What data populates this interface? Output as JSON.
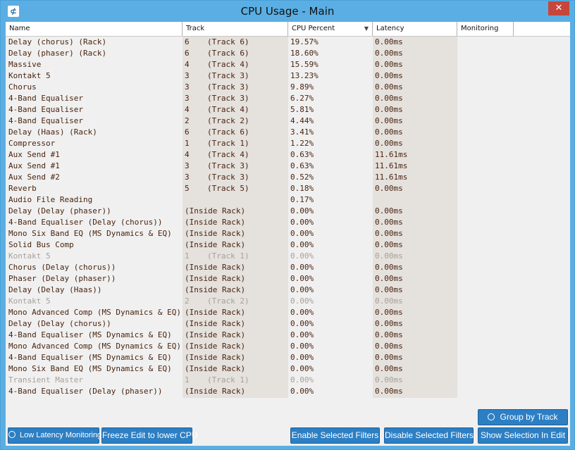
{
  "window": {
    "title": "CPU Usage - Main",
    "close_glyph": "✕",
    "app_icon_glyph": "⊄"
  },
  "table": {
    "columns": [
      "Name",
      "Track",
      "CPU Percent",
      "Latency",
      "Monitoring"
    ],
    "sorted_column": "CPU Percent",
    "sort_icon": "▼",
    "rows": [
      {
        "name": "Delay (chorus) (Rack)",
        "track_num": "6",
        "track_label": "(Track 6)",
        "cpu": "19.57%",
        "latency": "0.00ms",
        "dim": false
      },
      {
        "name": "Delay (phaser) (Rack)",
        "track_num": "6",
        "track_label": "(Track 6)",
        "cpu": "18.60%",
        "latency": "0.00ms",
        "dim": false
      },
      {
        "name": "Massive",
        "track_num": "4",
        "track_label": "(Track 4)",
        "cpu": "15.59%",
        "latency": "0.00ms",
        "dim": false
      },
      {
        "name": "Kontakt 5",
        "track_num": "3",
        "track_label": "(Track 3)",
        "cpu": "13.23%",
        "latency": "0.00ms",
        "dim": false
      },
      {
        "name": "Chorus",
        "track_num": "3",
        "track_label": "(Track 3)",
        "cpu": "9.89%",
        "latency": "0.00ms",
        "dim": false
      },
      {
        "name": "4-Band Equaliser",
        "track_num": "3",
        "track_label": "(Track 3)",
        "cpu": "6.27%",
        "latency": "0.00ms",
        "dim": false
      },
      {
        "name": "4-Band Equaliser",
        "track_num": "4",
        "track_label": "(Track 4)",
        "cpu": "5.81%",
        "latency": "0.00ms",
        "dim": false
      },
      {
        "name": "4-Band Equaliser",
        "track_num": "2",
        "track_label": "(Track 2)",
        "cpu": "4.44%",
        "latency": "0.00ms",
        "dim": false
      },
      {
        "name": "Delay (Haas) (Rack)",
        "track_num": "6",
        "track_label": "(Track 6)",
        "cpu": "3.41%",
        "latency": "0.00ms",
        "dim": false
      },
      {
        "name": "Compressor",
        "track_num": "1",
        "track_label": "(Track 1)",
        "cpu": "1.22%",
        "latency": "0.00ms",
        "dim": false
      },
      {
        "name": "Aux Send #1",
        "track_num": "4",
        "track_label": "(Track 4)",
        "cpu": "0.63%",
        "latency": "11.61ms",
        "dim": false
      },
      {
        "name": "Aux Send #1",
        "track_num": "3",
        "track_label": "(Track 3)",
        "cpu": "0.63%",
        "latency": "11.61ms",
        "dim": false
      },
      {
        "name": "Aux Send #2",
        "track_num": "3",
        "track_label": "(Track 3)",
        "cpu": "0.52%",
        "latency": "11.61ms",
        "dim": false
      },
      {
        "name": "Reverb",
        "track_num": "5",
        "track_label": "(Track 5)",
        "cpu": "0.18%",
        "latency": "0.00ms",
        "dim": false
      },
      {
        "name": "Audio File Reading",
        "track_num": "",
        "track_label": "",
        "cpu": "0.17%",
        "latency": "",
        "dim": false
      },
      {
        "name": "Delay (Delay (phaser))",
        "track_num": "(Inside Rack)",
        "track_label": "",
        "cpu": "0.00%",
        "latency": "0.00ms",
        "dim": false
      },
      {
        "name": "4-Band Equaliser (Delay (chorus))",
        "track_num": "(Inside Rack)",
        "track_label": "",
        "cpu": "0.00%",
        "latency": "0.00ms",
        "dim": false
      },
      {
        "name": "Mono Six Band EQ (MS Dynamics & EQ)",
        "track_num": "(Inside Rack)",
        "track_label": "",
        "cpu": "0.00%",
        "latency": "0.00ms",
        "dim": false
      },
      {
        "name": "Solid Bus Comp",
        "track_num": "(Inside Rack)",
        "track_label": "",
        "cpu": "0.00%",
        "latency": "0.00ms",
        "dim": false
      },
      {
        "name": "Kontakt 5",
        "track_num": "1",
        "track_label": "(Track 1)",
        "cpu": "0.00%",
        "latency": "0.00ms",
        "dim": true
      },
      {
        "name": "Chorus (Delay (chorus))",
        "track_num": "(Inside Rack)",
        "track_label": "",
        "cpu": "0.00%",
        "latency": "0.00ms",
        "dim": false
      },
      {
        "name": "Phaser (Delay (phaser))",
        "track_num": "(Inside Rack)",
        "track_label": "",
        "cpu": "0.00%",
        "latency": "0.00ms",
        "dim": false
      },
      {
        "name": "Delay (Delay (Haas))",
        "track_num": "(Inside Rack)",
        "track_label": "",
        "cpu": "0.00%",
        "latency": "0.00ms",
        "dim": false
      },
      {
        "name": "Kontakt 5",
        "track_num": "2",
        "track_label": "(Track 2)",
        "cpu": "0.00%",
        "latency": "0.00ms",
        "dim": true
      },
      {
        "name": "Mono Advanced Comp (MS Dynamics & EQ)",
        "track_num": "(Inside Rack)",
        "track_label": "",
        "cpu": "0.00%",
        "latency": "0.00ms",
        "dim": false
      },
      {
        "name": "Delay (Delay (chorus))",
        "track_num": "(Inside Rack)",
        "track_label": "",
        "cpu": "0.00%",
        "latency": "0.00ms",
        "dim": false
      },
      {
        "name": "4-Band Equaliser (MS Dynamics & EQ)",
        "track_num": "(Inside Rack)",
        "track_label": "",
        "cpu": "0.00%",
        "latency": "0.00ms",
        "dim": false
      },
      {
        "name": "Mono Advanced Comp (MS Dynamics & EQ)",
        "track_num": "(Inside Rack)",
        "track_label": "",
        "cpu": "0.00%",
        "latency": "0.00ms",
        "dim": false
      },
      {
        "name": "4-Band Equaliser (MS Dynamics & EQ)",
        "track_num": "(Inside Rack)",
        "track_label": "",
        "cpu": "0.00%",
        "latency": "0.00ms",
        "dim": false
      },
      {
        "name": "Mono Six Band EQ (MS Dynamics & EQ)",
        "track_num": "(Inside Rack)",
        "track_label": "",
        "cpu": "0.00%",
        "latency": "0.00ms",
        "dim": false
      },
      {
        "name": "Transient Master",
        "track_num": "1",
        "track_label": "(Track 1)",
        "cpu": "0.00%",
        "latency": "0.00ms",
        "dim": true
      },
      {
        "name": "4-Band Equaliser (Delay (phaser))",
        "track_num": "(Inside Rack)",
        "track_label": "",
        "cpu": "0.00%",
        "latency": "0.00ms",
        "dim": false
      }
    ]
  },
  "buttons": {
    "group_by_track": "Group by Track",
    "low_latency": "Low Latency Monitoring",
    "freeze_edit": "Freeze Edit to lower CPU",
    "enable_filters": "Enable Selected Filters",
    "disable_filters": "Disable Selected Filters",
    "show_selection": "Show Selection In Edit"
  },
  "colors": {
    "title_bar": "#5aaee3",
    "button_blue": "#2d7fc4",
    "row_text": "#4a2410",
    "row_text_dim": "#a8a09a",
    "close_red": "#c7463b"
  }
}
